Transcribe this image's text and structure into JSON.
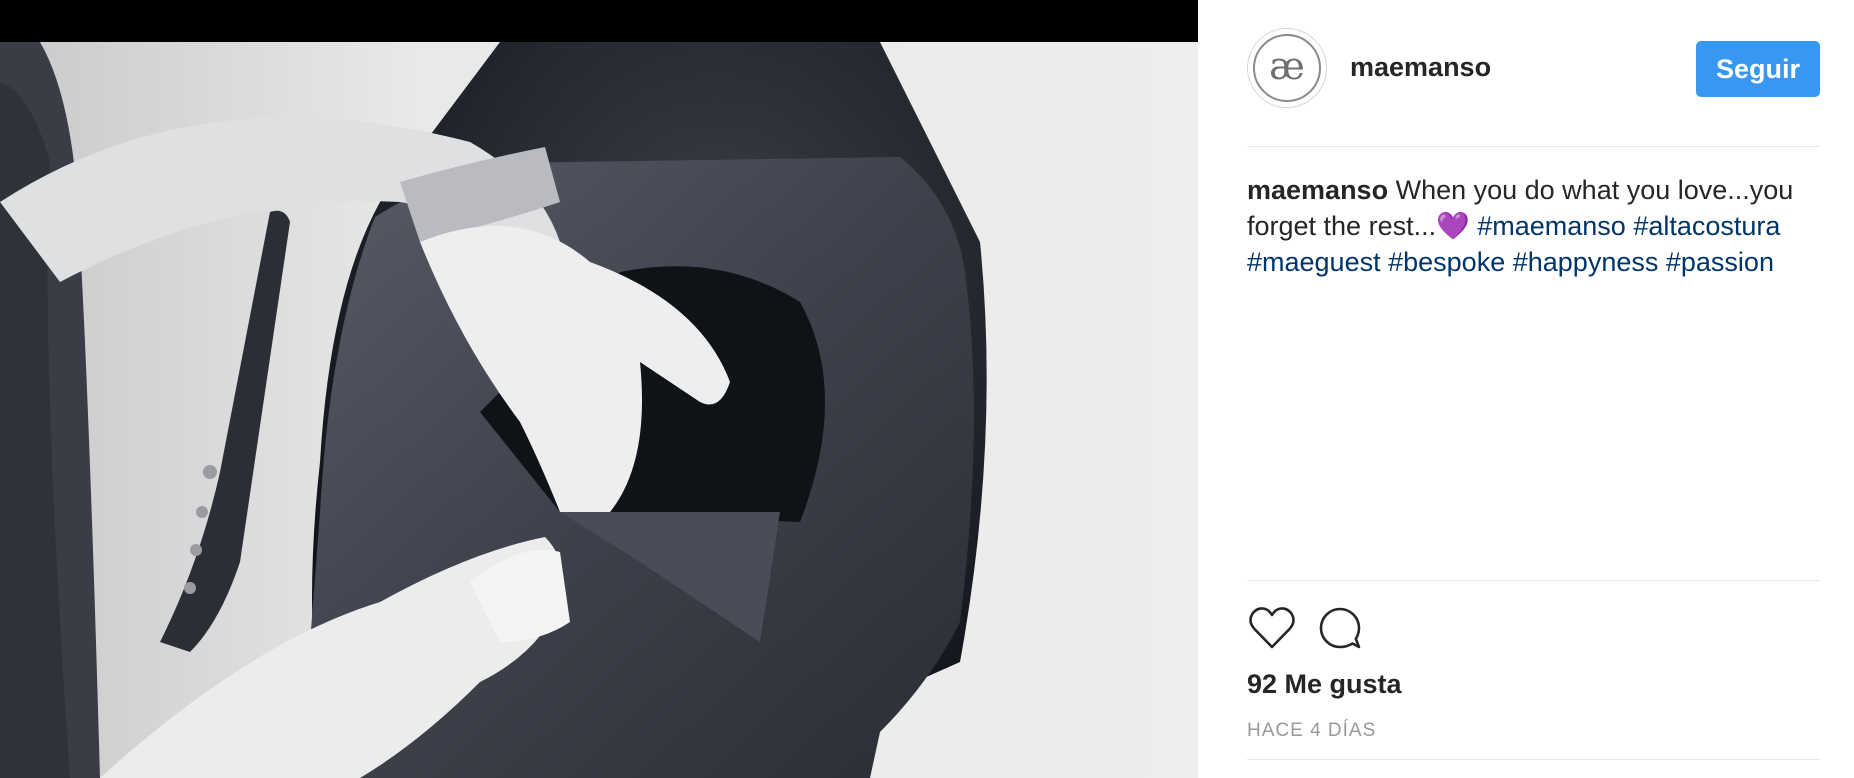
{
  "post": {
    "username": "maemanso",
    "avatar_text": "æ",
    "follow_label": "Seguir",
    "caption": {
      "author": "maemanso",
      "text": " When you do what you love...you forget the rest...",
      "emoji": "💜",
      "hashtags": [
        "#maemanso",
        "#altacostura",
        "#maeguest",
        "#bespoke",
        "#happyness",
        "#passion"
      ]
    },
    "likes": "92 Me gusta",
    "time": "HACE 4 DÍAS"
  },
  "icons": {
    "like": "heart-outline-icon",
    "comment": "speech-bubble-icon"
  },
  "colors": {
    "follow_button": "#3897f0",
    "hashtag": "#003569",
    "timestamp": "#999999",
    "divider": "#e6e6e6"
  }
}
